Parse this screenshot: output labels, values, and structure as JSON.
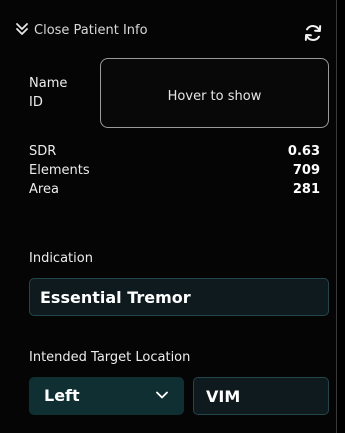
{
  "header": {
    "toggle_icon": "double-chevron-down-icon",
    "title": "Close Patient Info",
    "refresh_icon": "refresh-icon"
  },
  "patient": {
    "name_label": "Name",
    "id_label": "ID",
    "hover_text": "Hover to show"
  },
  "metrics": [
    {
      "label": "SDR",
      "value": "0.63"
    },
    {
      "label": "Elements",
      "value": "709"
    },
    {
      "label": "Area",
      "value": "281"
    }
  ],
  "indication": {
    "label": "Indication",
    "value": "Essential Tremor"
  },
  "target": {
    "label": "Intended Target Location",
    "side": "Left",
    "side_icon": "chevron-down-icon",
    "nucleus": "VIM"
  },
  "colors": {
    "background": "#050505",
    "field_bg": "#0e1a1d",
    "field_border": "#24464a",
    "select_bg": "#0f2f33"
  }
}
